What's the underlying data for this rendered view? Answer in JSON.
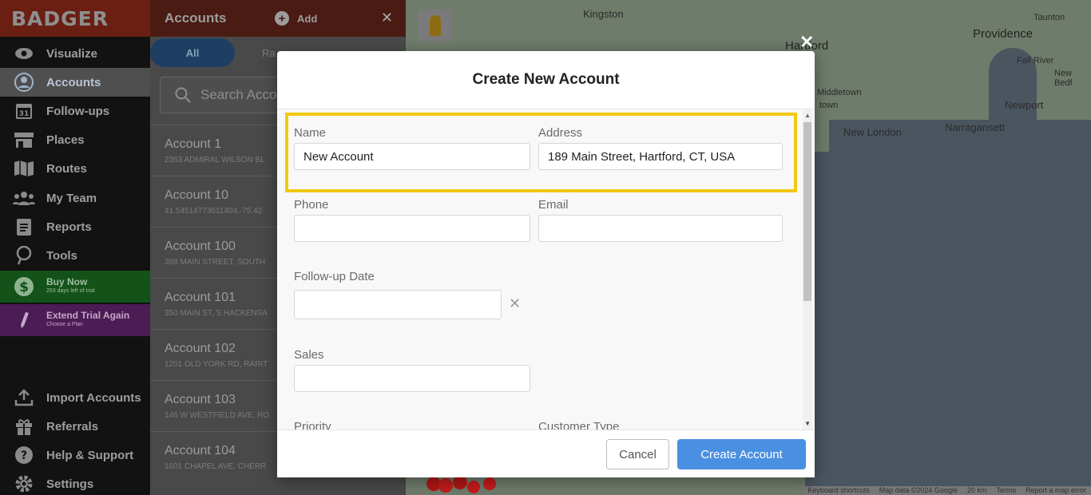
{
  "app": {
    "logo": "BADGER"
  },
  "nav": {
    "items": [
      {
        "label": "Visualize",
        "icon": "eye-icon"
      },
      {
        "label": "Accounts",
        "icon": "person-icon"
      },
      {
        "label": "Follow-ups",
        "icon": "calendar-icon",
        "badge": "31"
      },
      {
        "label": "Places",
        "icon": "store-icon"
      },
      {
        "label": "Routes",
        "icon": "map-icon"
      },
      {
        "label": "My Team",
        "icon": "team-icon"
      },
      {
        "label": "Reports",
        "icon": "report-icon"
      },
      {
        "label": "Tools",
        "icon": "pin-icon"
      }
    ],
    "buy_now": {
      "label": "Buy Now",
      "sub": "253 days left of trial"
    },
    "extend": {
      "label": "Extend Trial Again",
      "sub": "Choose a Plan"
    },
    "bottom": [
      {
        "label": "Import Accounts",
        "icon": "upload-icon"
      },
      {
        "label": "Referrals",
        "icon": "gift-icon"
      },
      {
        "label": "Help & Support",
        "icon": "help-icon"
      },
      {
        "label": "Settings",
        "icon": "gear-icon"
      }
    ]
  },
  "panel": {
    "title": "Accounts",
    "add_label": "Add",
    "tab_all": "All",
    "tab_r": "Ra",
    "search_placeholder": "Search Acco",
    "accounts": [
      {
        "name": "Account 1",
        "address": "2363 ADMIRAL WILSON BL"
      },
      {
        "name": "Account 10",
        "address": "41.54514773611404,-75.42"
      },
      {
        "name": "Account 100",
        "address": "368 MAIN STREET, SOUTH"
      },
      {
        "name": "Account 101",
        "address": "350 MAIN ST, S HACKENSA"
      },
      {
        "name": "Account 102",
        "address": "1201 OLD YORK RD, RARIT"
      },
      {
        "name": "Account 103",
        "address": "146 W WESTFIELD AVE, RO"
      },
      {
        "name": "Account 104",
        "address": "1601 CHAPEL AVE, CHERR"
      }
    ]
  },
  "map": {
    "labels": [
      "Kingston",
      "Hartford",
      "Providence",
      "New London",
      "Narragansett",
      "Newport",
      "Fall River",
      "New Bedf",
      "Taunton",
      "Middletown",
      "town"
    ],
    "footer": [
      "Keyboard shortcuts",
      "Map data ©2024 Google",
      "20 km",
      "Terms",
      "Report a map error"
    ]
  },
  "modal": {
    "title": "Create New Account",
    "name_label": "Name",
    "name_value": "New Account",
    "address_label": "Address",
    "address_value": "189 Main Street, Hartford, CT, USA",
    "phone_label": "Phone",
    "email_label": "Email",
    "followup_label": "Follow-up Date",
    "sales_label": "Sales",
    "priority_label": "Priority",
    "customer_type_label": "Customer Type",
    "cancel": "Cancel",
    "create": "Create Account"
  }
}
